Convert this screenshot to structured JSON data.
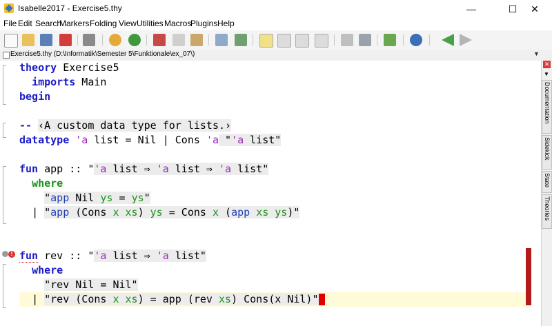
{
  "window": {
    "title": "Isabelle2017 - Exercise5.thy",
    "minimize": "—",
    "maximize": "☐",
    "close": "✕"
  },
  "menu": [
    "File",
    "Edit",
    "Search",
    "Markers",
    "Folding",
    "View",
    "Utilities",
    "Macros",
    "Plugins",
    "Help"
  ],
  "buffer": {
    "label": "Exercise5.thy (D:\\Informatik\\Semester 5\\Funktionale\\ex_07\\)"
  },
  "side_tabs": [
    "Documentation",
    "Sidekick",
    "State",
    "Theories"
  ],
  "code": {
    "l1_kw": "theory",
    "l1_rest": " Exercise5",
    "l2_kw": "imports",
    "l2_rest": " Main",
    "l3_kw": "begin",
    "l4_comment_prefix": "-- ",
    "l4_comment": "‹A custom data type for lists.›",
    "l5_kw": "datatype",
    "l5_a": "'a",
    "l5_mid": " list = Nil | Cons ",
    "l5_a2": "'a",
    "l5_q1": " \"",
    "l5_a3": "'a",
    "l5_end": " list\"",
    "l6_kw": "fun",
    "l6_name": " app :: \"",
    "l6_a1": "'a",
    "l6_t1": " list ⇒ ",
    "l6_a2": "'a",
    "l6_t2": " list ⇒ ",
    "l6_a3": "'a",
    "l6_t3": " list\"",
    "l7_kw": "where",
    "l8_q": "\"",
    "l8_app": "app",
    "l8_nil": " Nil ",
    "l8_ys": "ys",
    "l8_eq": " = ",
    "l8_ys2": "ys",
    "l8_end": "\"",
    "l9_bar": "| ",
    "l9_q": "\"",
    "l9_app": "app",
    "l9_p1": " (Cons ",
    "l9_x": "x",
    "l9_sp": " ",
    "l9_xs": "xs",
    "l9_p2": ") ",
    "l9_ys": "ys",
    "l9_eq": " = Cons ",
    "l9_x2": "x",
    "l9_p3": " (",
    "l9_app2": "app",
    "l9_sp2": " ",
    "l9_xs2": "xs",
    "l9_sp3": " ",
    "l9_ys2": "ys",
    "l9_end": ")\"",
    "l10_kw": "fun",
    "l10_name": " rev :: \"",
    "l10_a1": "'a",
    "l10_t1": " list ⇒ ",
    "l10_a2": "'a",
    "l10_t2": " list\"",
    "l11_kw": "where",
    "l12_text": "\"rev Nil = Nil\"",
    "l13_bar": "| ",
    "l13_q": "\"rev (Cons ",
    "l13_x": "x",
    "l13_sp": " ",
    "l13_xs": "xs",
    "l13_mid": ") = app (rev ",
    "l13_xs2": "xs",
    "l13_end": ") Cons(x Nil)\""
  },
  "icons": {
    "error": "error-icon",
    "info": "info-icon"
  },
  "colors": {
    "keyword": "#1a1ac9",
    "type_var": "#9d2bb7",
    "free_var": "#1b8f1b",
    "bound_var": "#1f3fb5",
    "error": "#b31b1b",
    "cursor_line": "#fffbd8"
  }
}
